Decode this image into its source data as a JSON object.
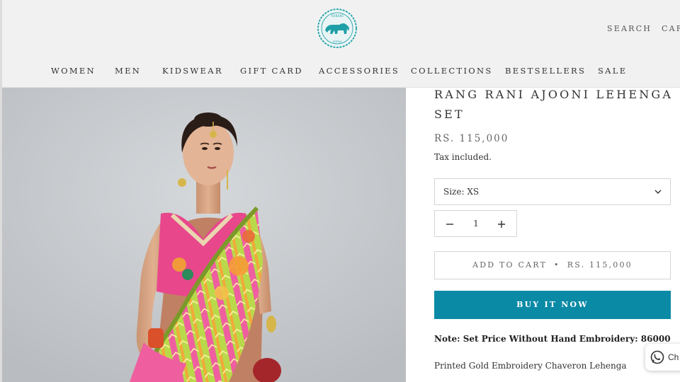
{
  "brand": {
    "logo_text_top": "TORANI",
    "logo_text_bottom": "INDIA"
  },
  "header": {
    "search_label": "SEARCH",
    "cart_label": "CAR"
  },
  "nav": {
    "items": [
      "WOMEN",
      "MEN",
      "KIDSWEAR",
      "GIFT CARD",
      "ACCESSORIES",
      "COLLECTIONS",
      "BESTSELLERS",
      "SALE"
    ]
  },
  "product": {
    "title": "RANG RANI AJOONI LEHENGA SET",
    "price": "RS. 115,000",
    "tax_note": "Tax included.",
    "size_label": "Size: XS",
    "quantity": "1",
    "add_to_cart_label": "ADD TO CART",
    "add_to_cart_price": "RS. 115,000",
    "buy_now_label": "BUY IT NOW",
    "note": "Note: Set Price Without Hand Embroidery: 86000",
    "description": "Printed Gold Embroidery Chaveron Lehenga"
  },
  "chat": {
    "label": "Ch"
  },
  "colors": {
    "accent": "#0b8aa6",
    "header_bg": "#f1f1f1",
    "hero_bg": "#c7cacd",
    "logo": "#1fa0a8"
  },
  "icons": [
    "logo-icon",
    "chevron-down-icon",
    "minus-icon",
    "plus-icon",
    "whatsapp-icon"
  ]
}
